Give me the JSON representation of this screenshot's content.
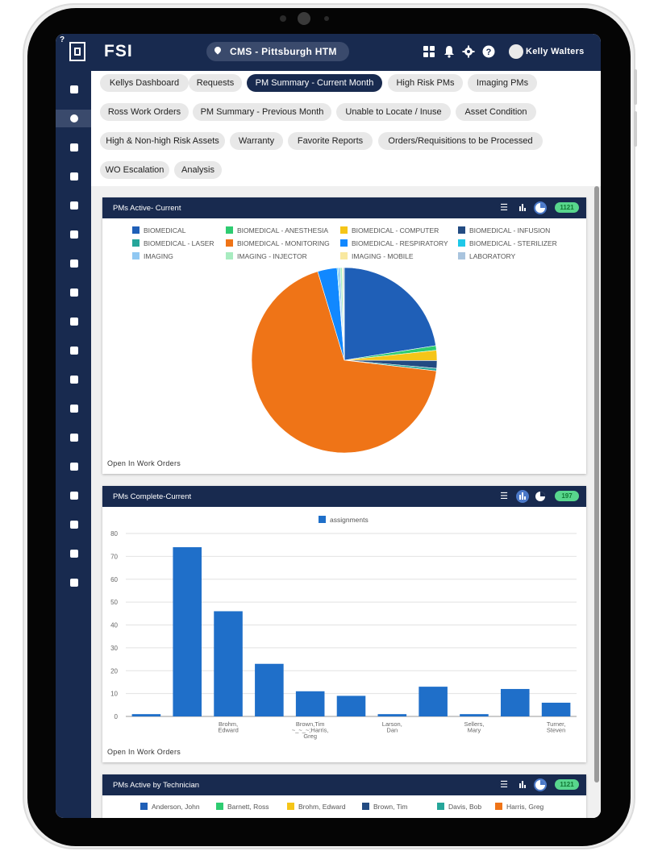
{
  "app": {
    "logo_text": "FSI",
    "location": "CMS - Pittsburgh HTM",
    "user_name": "Kelly Walters"
  },
  "tabs": [
    {
      "label": "Kellys Dashboard",
      "active": false
    },
    {
      "label": "Requests",
      "active": false
    },
    {
      "label": "PM Summary - Current Month",
      "active": true
    },
    {
      "label": "High Risk PMs",
      "active": false
    },
    {
      "label": "Imaging PMs",
      "active": false
    },
    {
      "label": "Ross Work Orders",
      "active": false
    },
    {
      "label": "PM Summary - Previous Month",
      "active": false
    },
    {
      "label": "Unable to Locate / Inuse",
      "active": false
    },
    {
      "label": "Asset Condition",
      "active": false
    },
    {
      "label": "High & Non-high Risk Assets",
      "active": false
    },
    {
      "label": "Warranty",
      "active": false
    },
    {
      "label": "Favorite Reports",
      "active": false
    },
    {
      "label": "Orders/Requisitions to be Processed",
      "active": false
    },
    {
      "label": "WO Escalation",
      "active": false
    },
    {
      "label": "Analysis",
      "active": false
    }
  ],
  "cards": {
    "pie": {
      "title": "PMs Active- Current",
      "badge": "1121",
      "footer": "Open In Work Orders"
    },
    "bar": {
      "title": "PMs Complete-Current",
      "badge": "197",
      "footer": "Open In Work Orders"
    },
    "tech": {
      "title": "PMs Active by Technician",
      "badge": "1121"
    }
  },
  "chart_data": [
    {
      "type": "pie",
      "title": "PMs Active- Current",
      "legend_position": "top",
      "series": [
        {
          "name": "BIOMEDICAL",
          "value": 252,
          "color": "#1f5fb7"
        },
        {
          "name": "BIOMEDICAL - ANESTHESIA",
          "value": 9,
          "color": "#2ecc71"
        },
        {
          "name": "BIOMEDICAL - COMPUTER",
          "value": 20,
          "color": "#f5c518"
        },
        {
          "name": "BIOMEDICAL - INFUSION",
          "value": 15,
          "color": "#234b82"
        },
        {
          "name": "BIOMEDICAL - LASER",
          "value": 5,
          "color": "#26a69a"
        },
        {
          "name": "BIOMEDICAL - MONITORING",
          "value": 768,
          "color": "#ef7417"
        },
        {
          "name": "BIOMEDICAL - RESPIRATORY",
          "value": 38,
          "color": "#1188ff"
        },
        {
          "name": "BIOMEDICAL - STERILIZER",
          "value": 2,
          "color": "#1ec8e8"
        },
        {
          "name": "IMAGING",
          "value": 4,
          "color": "#90c8f2"
        },
        {
          "name": "IMAGING - INJECTOR",
          "value": 4,
          "color": "#a8ecc0"
        },
        {
          "name": "IMAGING - MOBILE",
          "value": 2,
          "color": "#f8e8a0"
        },
        {
          "name": "LABORATORY",
          "value": 2,
          "color": "#a9c4de"
        }
      ]
    },
    {
      "type": "bar",
      "title": "PMs Complete-Current",
      "legend": [
        "assignments"
      ],
      "ylim": [
        0,
        80
      ],
      "yticks": [
        0,
        10,
        20,
        30,
        40,
        50,
        60,
        70,
        80
      ],
      "grid": true,
      "color": "#1f6fc9",
      "categories": [
        "",
        "",
        "Brohm, Edward",
        "",
        "Brown, Tim;~_~_~;Harris, Greg",
        "",
        "Larson, Dan",
        "",
        "Sellers, Mary",
        "",
        "Turner, Steven"
      ],
      "values": [
        1,
        74,
        46,
        23,
        11,
        9,
        1,
        13,
        1,
        12,
        6
      ]
    },
    {
      "type": "bar",
      "title": "PMs Active by Technician",
      "legend": [
        {
          "name": "Anderson, John",
          "color": "#1f5fb7"
        },
        {
          "name": "Barnett, Ross",
          "color": "#2ecc71"
        },
        {
          "name": "Brohm, Edward",
          "color": "#f5c518"
        },
        {
          "name": "Brown, Tim",
          "color": "#234b82"
        },
        {
          "name": "Davis, Bob",
          "color": "#26a69a"
        },
        {
          "name": "Harris, Greg",
          "color": "#ef7417"
        }
      ]
    }
  ],
  "icons": {
    "topbar": [
      "grid-icon",
      "bell-icon",
      "gear-icon",
      "help-icon"
    ],
    "sidebar": [
      "chart-icon",
      "pie-icon",
      "inbox-icon",
      "cogs-icon",
      "note-icon",
      "calendar-icon",
      "edit-icon",
      "copy-icon",
      "building-icon",
      "id-card-icon",
      "sitemap-icon",
      "box-icon",
      "cart-icon",
      "book-icon",
      "table-icon",
      "folder-icon",
      "comments-icon",
      "clone-icon"
    ]
  }
}
